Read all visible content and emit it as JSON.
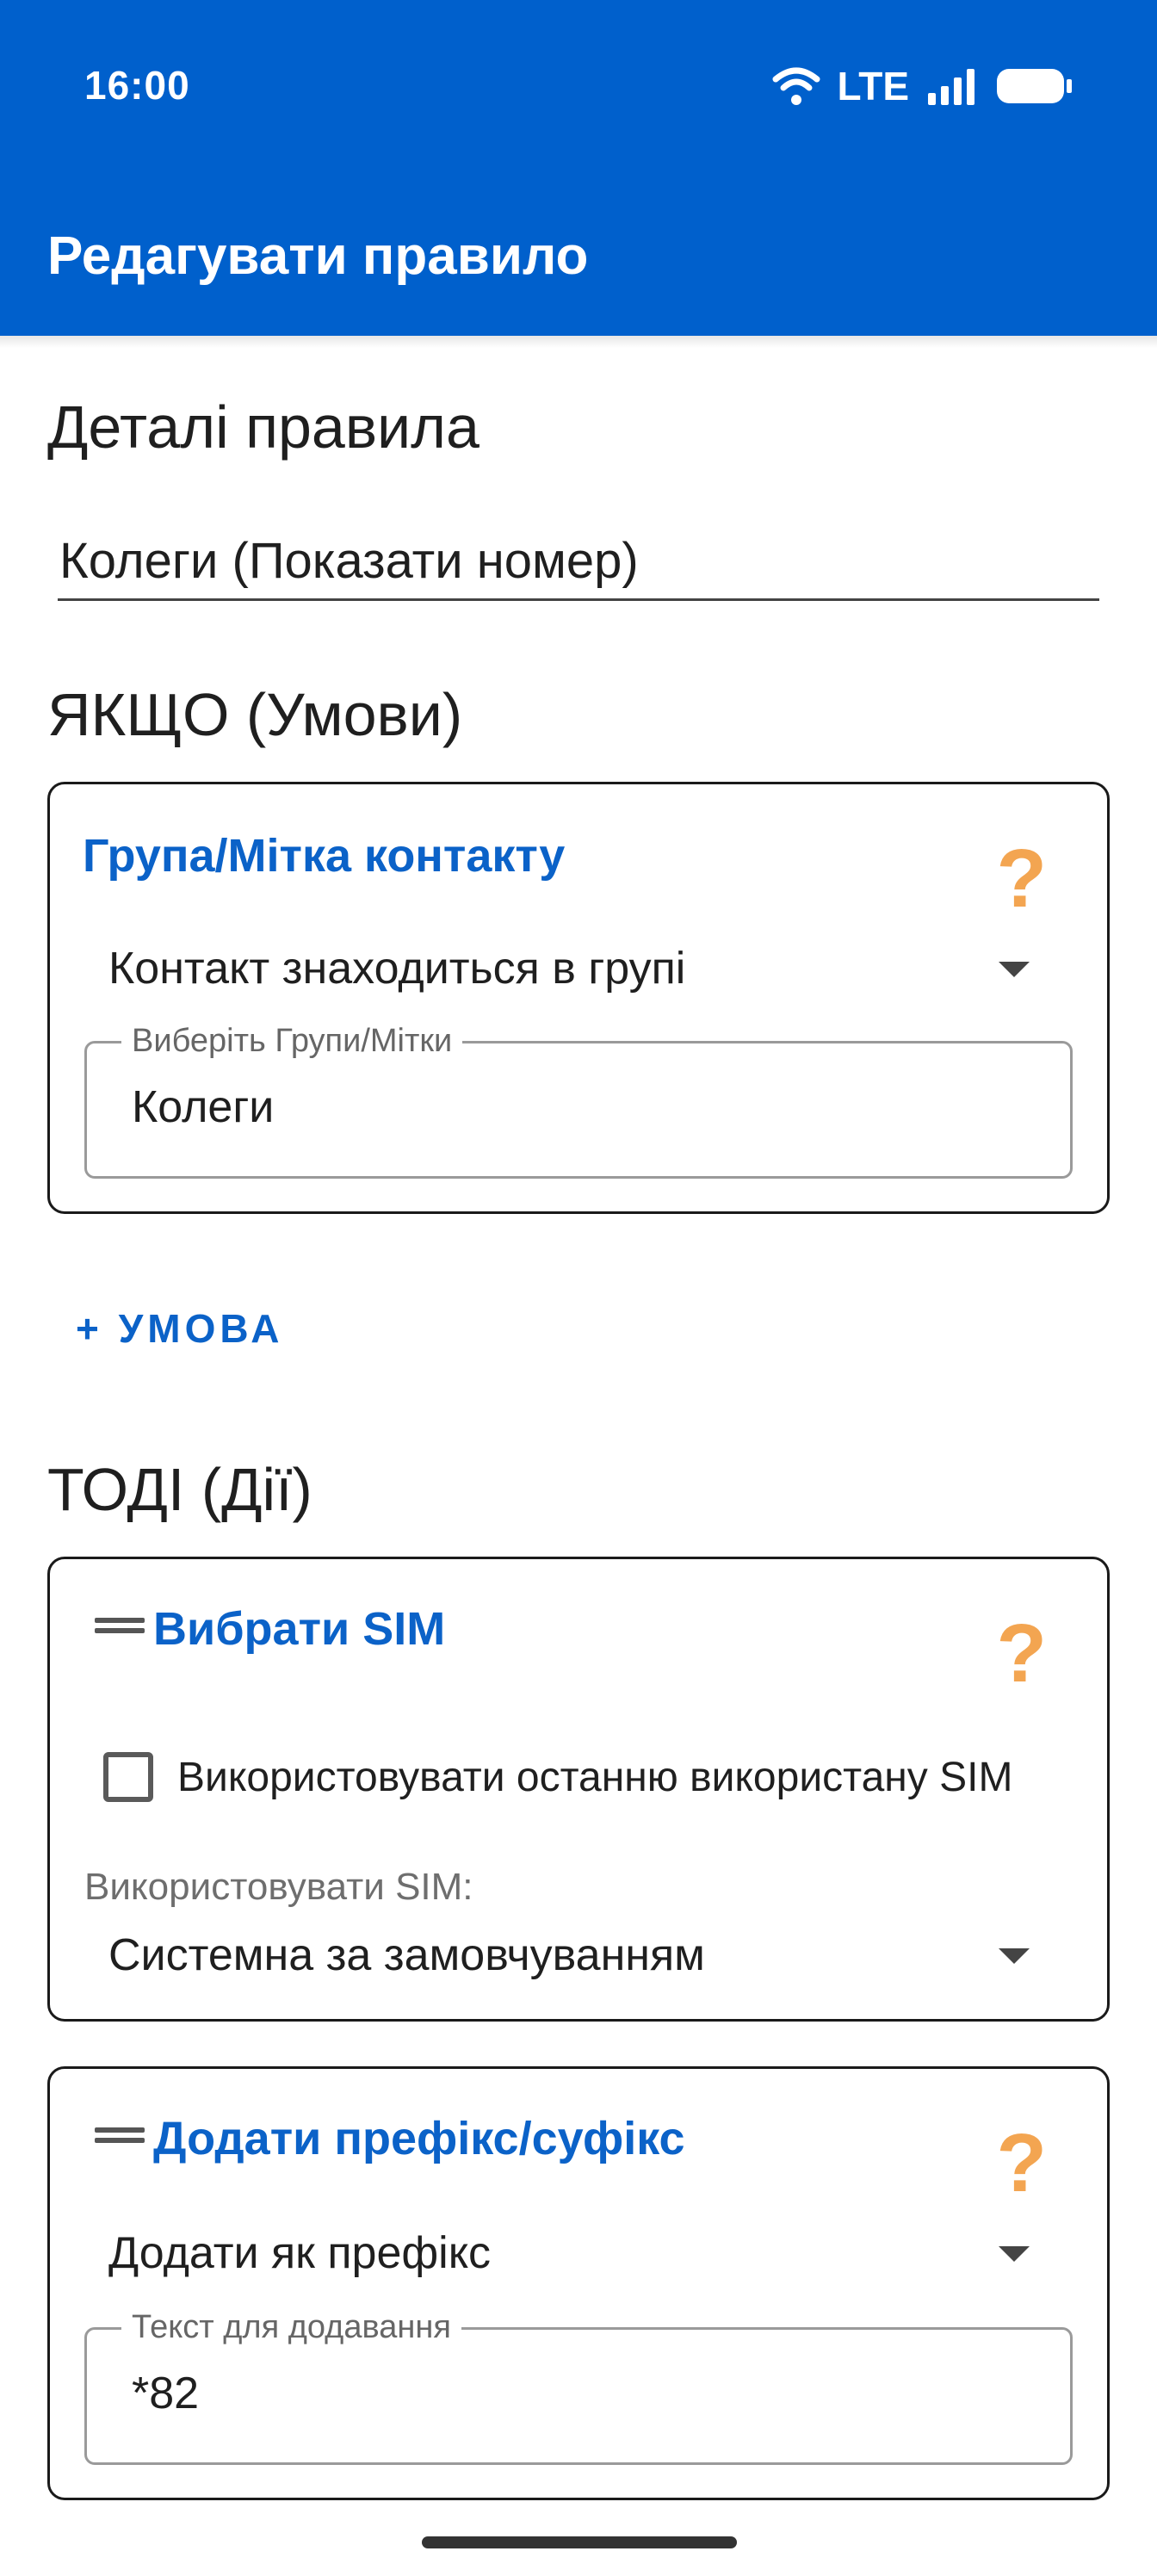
{
  "status_bar": {
    "time": "16:00",
    "network": "LTE",
    "icons": [
      "wifi-icon",
      "signal-icon",
      "battery-icon"
    ]
  },
  "app_bar": {
    "title": "Редагувати правило"
  },
  "rule_details": {
    "heading": "Деталі правила",
    "name_value": "Колеги (Показати номер)"
  },
  "conditions": {
    "heading": "ЯКЩО (Умови)",
    "items": [
      {
        "title": "Група/Мітка контакту",
        "operator": "Контакт знаходиться в групі",
        "field_label": "Виберіть Групи/Мітки",
        "field_value": "Колеги"
      }
    ],
    "add_label": "+ УМОВА"
  },
  "actions": {
    "heading": "ТОДІ (Дії)",
    "items": [
      {
        "title": "Вибрати SIM",
        "checkbox_label": "Використовувати останню використану SIM",
        "checkbox_checked": false,
        "sim_label": "Використовувати SIM:",
        "sim_value": "Системна за замовчуванням"
      },
      {
        "title": "Додати префікс/суфікс",
        "mode": "Додати як префікс",
        "field_label": "Текст для додавання",
        "field_value": "*82"
      }
    ]
  },
  "help_glyph": "?",
  "colors": {
    "app_bar": "#0060cc",
    "accent": "#0b62c8",
    "help": "#f3a551"
  }
}
